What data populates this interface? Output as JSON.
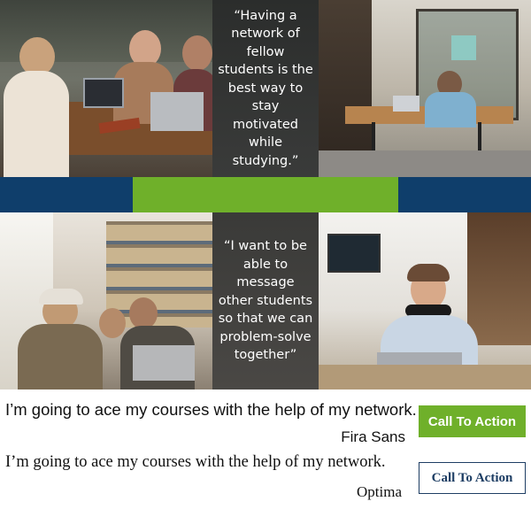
{
  "quotes": {
    "top": "“Having a network of fellow students is the best way to stay motivated while studying.”",
    "bottom": "“I want to be able to message other students so that we can problem-solve together”"
  },
  "band_colors": {
    "left": "#0f3e6b",
    "middle": "#6fb02a",
    "right": "#0f3e6b"
  },
  "samples": [
    {
      "text": "I’m going to ace my courses with the help of my network.",
      "font_label": "Fira Sans",
      "cta_label": "Call To Action",
      "cta_style": "filled"
    },
    {
      "text": "I’m going to ace my courses with the help of my network.",
      "font_label": "Optima",
      "cta_label": "Call To Action",
      "cta_style": "outline"
    }
  ],
  "colors": {
    "cta_green": "#6fb02a",
    "navy": "#1e3e64"
  }
}
